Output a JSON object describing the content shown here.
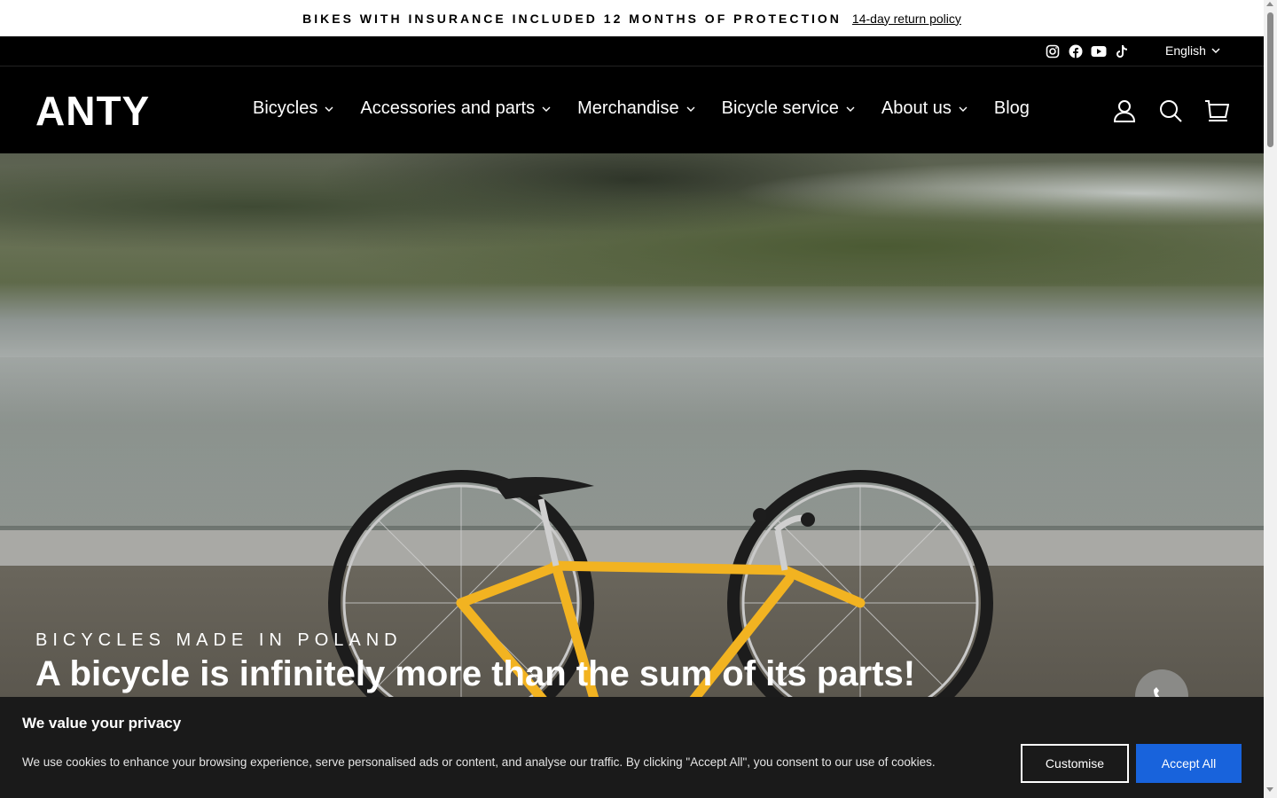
{
  "announcement": {
    "message": "BIKES WITH INSURANCE INCLUDED 12 MONTHS OF PROTECTION",
    "link": "14-day return policy"
  },
  "utility": {
    "social_icons": [
      "instagram-icon",
      "facebook-icon",
      "youtube-icon",
      "tiktok-icon"
    ],
    "language": "English"
  },
  "header": {
    "logo": "ANTY",
    "nav": [
      {
        "label": "Bicycles",
        "has_dropdown": true
      },
      {
        "label": "Accessories and parts",
        "has_dropdown": true
      },
      {
        "label": "Merchandise",
        "has_dropdown": true
      },
      {
        "label": "Bicycle service",
        "has_dropdown": true
      },
      {
        "label": "About us",
        "has_dropdown": true
      },
      {
        "label": "Blog",
        "has_dropdown": false
      }
    ],
    "icons": [
      "account-icon",
      "search-icon",
      "cart-icon"
    ]
  },
  "hero": {
    "subtitle": "BICYCLES MADE IN POLAND",
    "title": "A bicycle is infinitely more than the sum of its parts!"
  },
  "cookie": {
    "title": "We value your privacy",
    "text": "We use cookies to enhance your browsing experience, serve personalised ads or content, and analyse our traffic. By clicking \"Accept All\", you consent to our use of cookies.",
    "customise_label": "Customise",
    "accept_label": "Accept All"
  },
  "colors": {
    "accent": "#1863dc",
    "header_bg": "#000000",
    "bike_frame": "#f2b321"
  }
}
